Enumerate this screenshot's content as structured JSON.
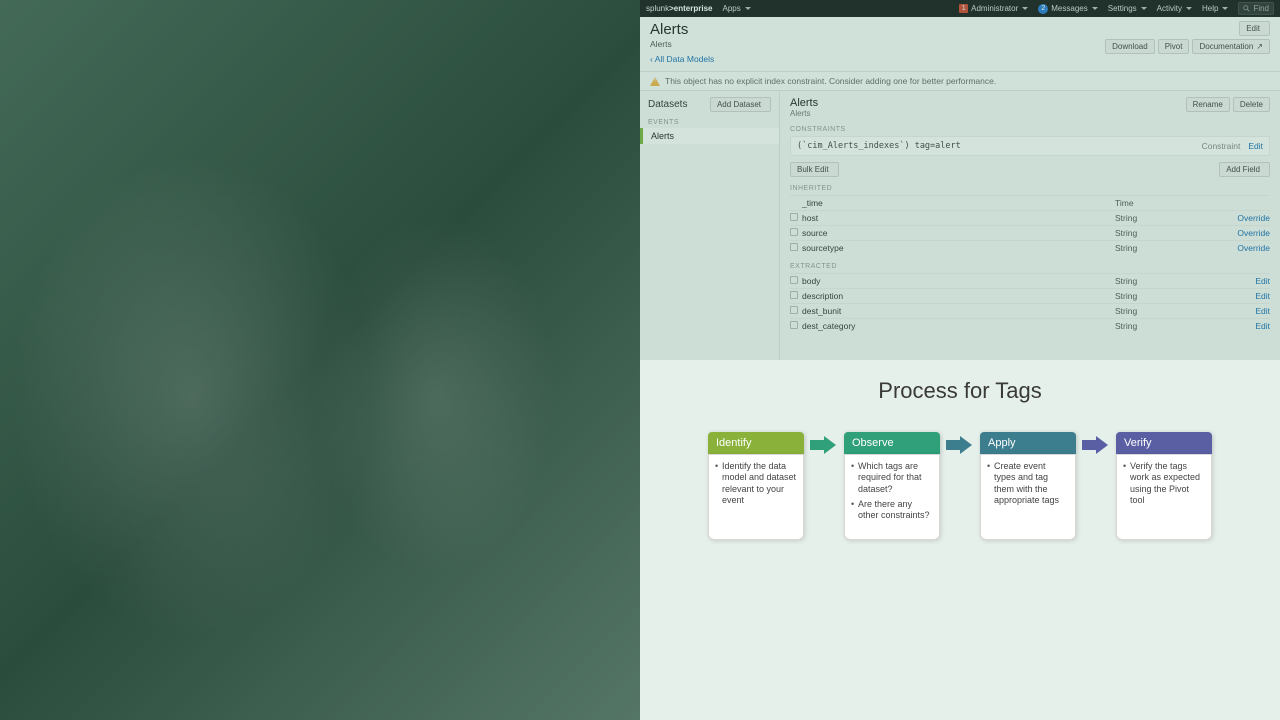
{
  "topbar": {
    "brand_a": "splunk",
    "brand_b": ">enterprise",
    "apps": "Apps",
    "admin": "Administrator",
    "messages": "Messages",
    "messages_count": "2",
    "settings": "Settings",
    "activity": "Activity",
    "help": "Help",
    "find": "Find",
    "alert_count": "1"
  },
  "page": {
    "title": "Alerts",
    "crumb": "Alerts",
    "back": "All Data Models",
    "edit": "Edit",
    "download": "Download",
    "pivot": "Pivot",
    "docs": "Documentation"
  },
  "warning": "This object has no explicit index constraint. Consider adding one for better performance.",
  "sidebar": {
    "title": "Datasets",
    "add": "Add Dataset",
    "group": "EVENTS",
    "items": [
      "Alerts"
    ]
  },
  "main": {
    "title": "Alerts",
    "sub": "Alerts",
    "rename": "Rename",
    "delete": "Delete",
    "constraints_label": "CONSTRAINTS",
    "constraint_expr": "(`cim_Alerts_indexes`) tag=alert",
    "constraint_word": "Constraint",
    "constraint_edit": "Edit",
    "bulk_edit": "Bulk Edit",
    "add_field": "Add Field",
    "inherited_label": "INHERITED",
    "inherited_head_type": "Time",
    "inherited": [
      {
        "name": "_time",
        "type": "",
        "act": ""
      },
      {
        "name": "host",
        "type": "String",
        "act": "Override"
      },
      {
        "name": "source",
        "type": "String",
        "act": "Override"
      },
      {
        "name": "sourcetype",
        "type": "String",
        "act": "Override"
      }
    ],
    "extracted_label": "EXTRACTED",
    "extracted": [
      {
        "name": "body",
        "type": "String",
        "act": "Edit"
      },
      {
        "name": "description",
        "type": "String",
        "act": "Edit"
      },
      {
        "name": "dest_bunit",
        "type": "String",
        "act": "Edit"
      },
      {
        "name": "dest_category",
        "type": "String",
        "act": "Edit"
      }
    ]
  },
  "diagram": {
    "title": "Process for Tags",
    "steps": [
      {
        "label": "Identify",
        "color": "#8ab23a",
        "arrow": "#8ab23a",
        "bullets": [
          "Identify the data model and dataset relevant to your event"
        ]
      },
      {
        "label": "Observe",
        "color": "#2fa07a",
        "arrow": "#2fa07a",
        "bullets": [
          "Which tags are required for that dataset?",
          "Are there any other constraints?"
        ]
      },
      {
        "label": "Apply",
        "color": "#3c7e8e",
        "arrow": "#3c7e8e",
        "bullets": [
          "Create event types and tag them with the appropriate tags"
        ]
      },
      {
        "label": "Verify",
        "color": "#5a5fa4",
        "arrow": "#5a5fa4",
        "bullets": [
          "Verify the tags work as expected using the Pivot tool"
        ]
      }
    ]
  }
}
